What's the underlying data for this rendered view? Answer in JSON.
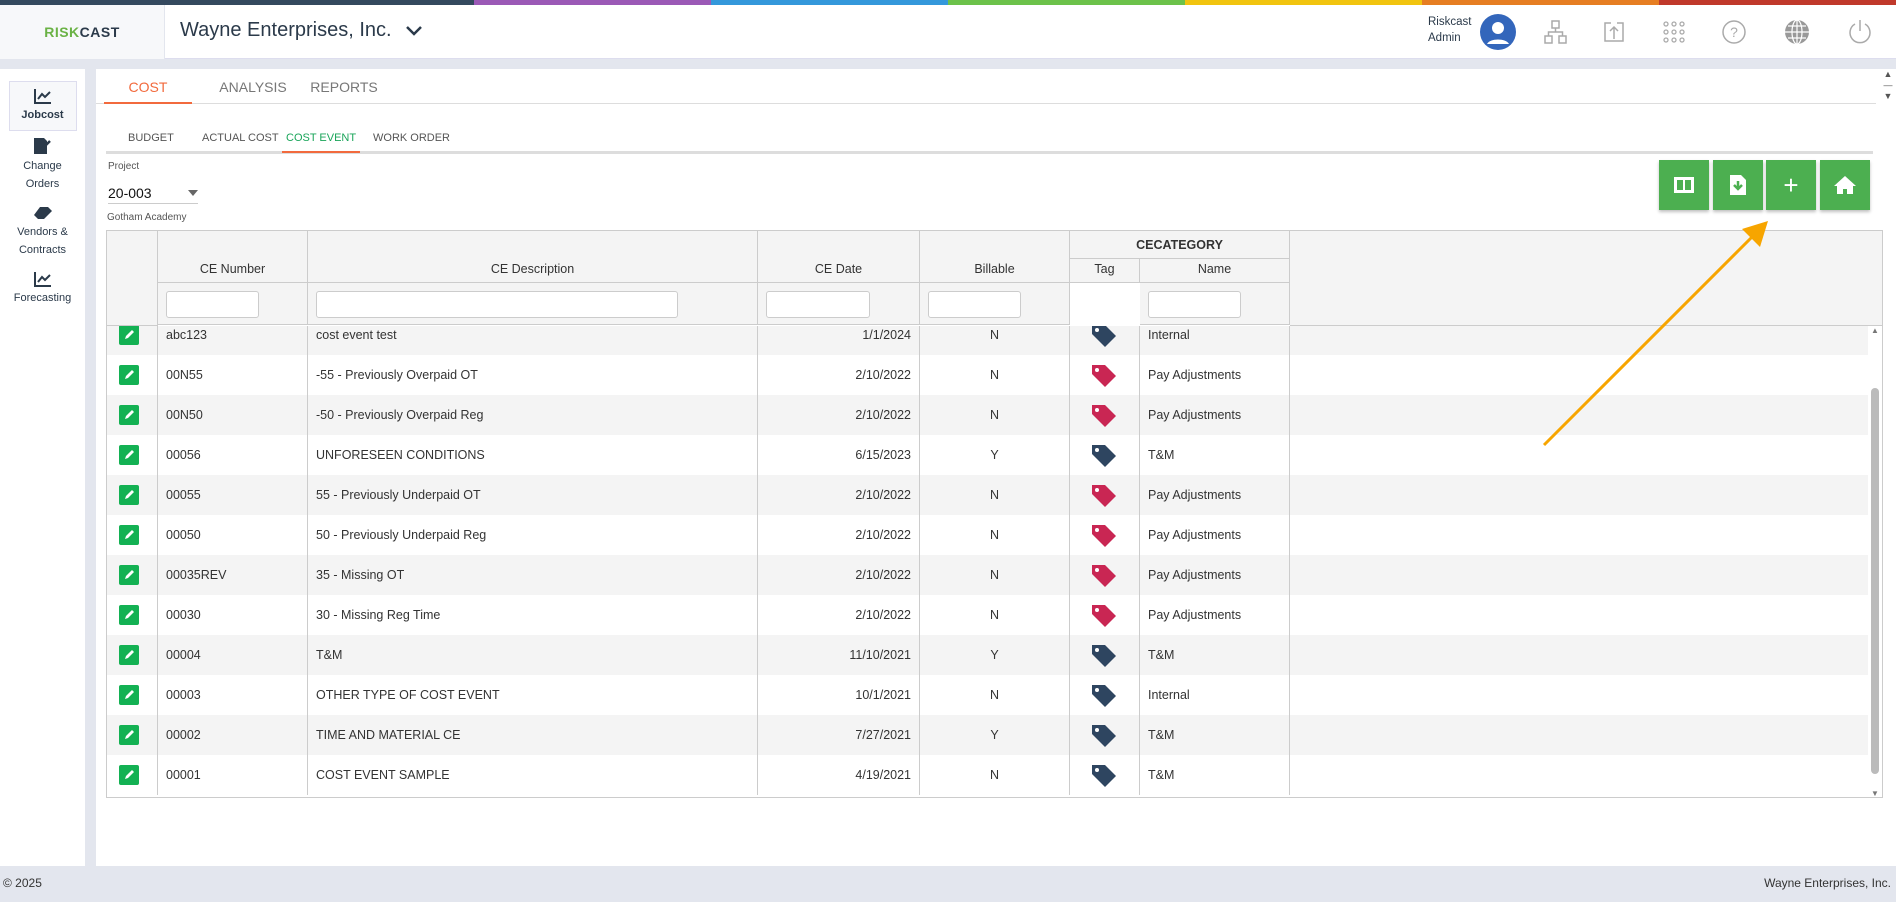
{
  "brand": {
    "logo_green": "RISK",
    "logo_dark": "CAST",
    "company": "Wayne Enterprises, Inc.",
    "accent": "#f26a3d",
    "green": "#4caf50"
  },
  "user": {
    "line1": "Riskcast",
    "line2": "Admin"
  },
  "header_icons": [
    "org-chart-icon",
    "upload-icon",
    "apps-grid-icon",
    "help-icon",
    "globe-icon",
    "power-icon"
  ],
  "sidebar": [
    {
      "label1": "Jobcost",
      "label2": ""
    },
    {
      "label1": "Change",
      "label2": "Orders"
    },
    {
      "label1": "Vendors &",
      "label2": "Contracts"
    },
    {
      "label1": "Forecasting",
      "label2": ""
    }
  ],
  "tabs": [
    "COST",
    "ANALYSIS",
    "REPORTS"
  ],
  "subtabs": [
    "BUDGET",
    "ACTUAL COST",
    "COST EVENT",
    "WORK ORDER"
  ],
  "project": {
    "label": "Project",
    "value": "20-003",
    "name": "Gotham Academy"
  },
  "toolbar": [
    "columns-icon",
    "export-icon",
    "add-icon",
    "home-icon"
  ],
  "table": {
    "group_header": "CECATEGORY",
    "columns": [
      "CE Number",
      "CE Description",
      "CE Date",
      "Billable",
      "Tag",
      "Name"
    ],
    "rows": [
      {
        "num": "abc123",
        "desc": "cost event test",
        "date": "1/1/2024",
        "bill": "N",
        "tag": "#2e4560",
        "name": "Internal"
      },
      {
        "num": "00N55",
        "desc": "-55 - Previously Overpaid OT",
        "date": "2/10/2022",
        "bill": "N",
        "tag": "#c92653",
        "name": "Pay Adjustments"
      },
      {
        "num": "00N50",
        "desc": "-50 - Previously Overpaid Reg",
        "date": "2/10/2022",
        "bill": "N",
        "tag": "#c92653",
        "name": "Pay Adjustments"
      },
      {
        "num": "00056",
        "desc": "UNFORESEEN CONDITIONS",
        "date": "6/15/2023",
        "bill": "Y",
        "tag": "#2e4560",
        "name": "T&M"
      },
      {
        "num": "00055",
        "desc": "55 - Previously Underpaid OT",
        "date": "2/10/2022",
        "bill": "N",
        "tag": "#c92653",
        "name": "Pay Adjustments"
      },
      {
        "num": "00050",
        "desc": "50 - Previously Underpaid Reg",
        "date": "2/10/2022",
        "bill": "N",
        "tag": "#c92653",
        "name": "Pay Adjustments"
      },
      {
        "num": "00035REV",
        "desc": "35 - Missing OT",
        "date": "2/10/2022",
        "bill": "N",
        "tag": "#c92653",
        "name": "Pay Adjustments"
      },
      {
        "num": "00030",
        "desc": "30 - Missing Reg Time",
        "date": "2/10/2022",
        "bill": "N",
        "tag": "#c92653",
        "name": "Pay Adjustments"
      },
      {
        "num": "00004",
        "desc": "T&M",
        "date": "11/10/2021",
        "bill": "Y",
        "tag": "#2e4560",
        "name": "T&M"
      },
      {
        "num": "00003",
        "desc": "OTHER TYPE OF COST EVENT",
        "date": "10/1/2021",
        "bill": "N",
        "tag": "#2e4560",
        "name": "Internal"
      },
      {
        "num": "00002",
        "desc": "TIME AND MATERIAL CE",
        "date": "7/27/2021",
        "bill": "Y",
        "tag": "#2e4560",
        "name": "T&M"
      },
      {
        "num": "00001",
        "desc": "COST EVENT SAMPLE",
        "date": "4/19/2021",
        "bill": "N",
        "tag": "#2e4560",
        "name": "T&M"
      }
    ]
  },
  "footer": {
    "left": "© 2025",
    "right": "Wayne Enterprises, Inc."
  }
}
